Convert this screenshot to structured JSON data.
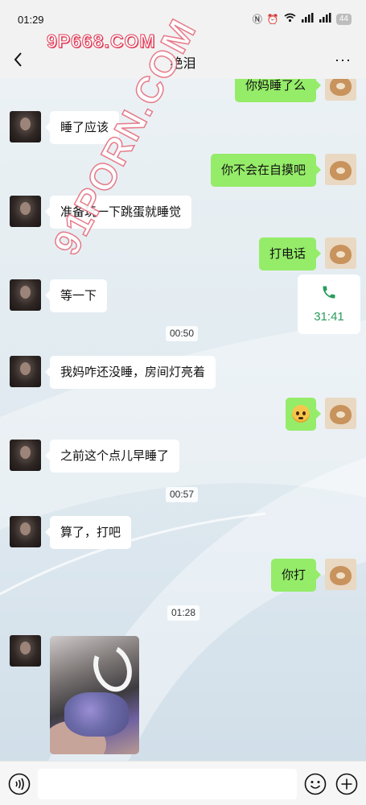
{
  "status_bar": {
    "time": "01:29",
    "battery": "44",
    "icons": [
      "nfc-icon",
      "alarm-icon",
      "wifi-icon",
      "signal-5g-icon",
      "signal-5g-icon"
    ]
  },
  "watermarks": {
    "top": "9P668.COM",
    "diagonal": "91PORN.COM"
  },
  "header": {
    "title": "绝泪",
    "back_icon": "chevron-left-icon",
    "more_icon": "more-dots-icon"
  },
  "messages": [
    {
      "side": "out",
      "type": "text",
      "text": "你妈睡了么"
    },
    {
      "side": "in",
      "type": "text",
      "text": "睡了应该"
    },
    {
      "side": "out",
      "type": "text",
      "text": "你不会在自摸吧"
    },
    {
      "side": "in",
      "type": "text",
      "text": "准备玩一下跳蛋就睡觉"
    },
    {
      "side": "out",
      "type": "text",
      "text": "打电话"
    },
    {
      "side": "in",
      "type": "text",
      "text": "等一下"
    },
    {
      "side": "out",
      "type": "call",
      "duration": "31:41",
      "icon": "phone-icon"
    },
    {
      "type": "time",
      "text": "00:50"
    },
    {
      "side": "in",
      "type": "text",
      "text": "我妈咋还没睡，房间灯亮着"
    },
    {
      "side": "out",
      "type": "emoji",
      "icon": "smirk-emoji-icon"
    },
    {
      "side": "in",
      "type": "text",
      "text": "之前这个点儿早睡了"
    },
    {
      "type": "time",
      "text": "00:57"
    },
    {
      "side": "in",
      "type": "text",
      "text": "算了，打吧"
    },
    {
      "side": "out",
      "type": "text",
      "text": "你打"
    },
    {
      "type": "time",
      "text": "01:28"
    },
    {
      "side": "in",
      "type": "image"
    }
  ],
  "input_bar": {
    "placeholder": "",
    "icons": [
      "voice-icon",
      "smile-icon",
      "plus-icon"
    ]
  },
  "colors": {
    "outgoing_bubble": "#95ec69",
    "incoming_bubble": "#ffffff",
    "call_text": "#2a9d5c",
    "watermark": "#e13a56"
  }
}
